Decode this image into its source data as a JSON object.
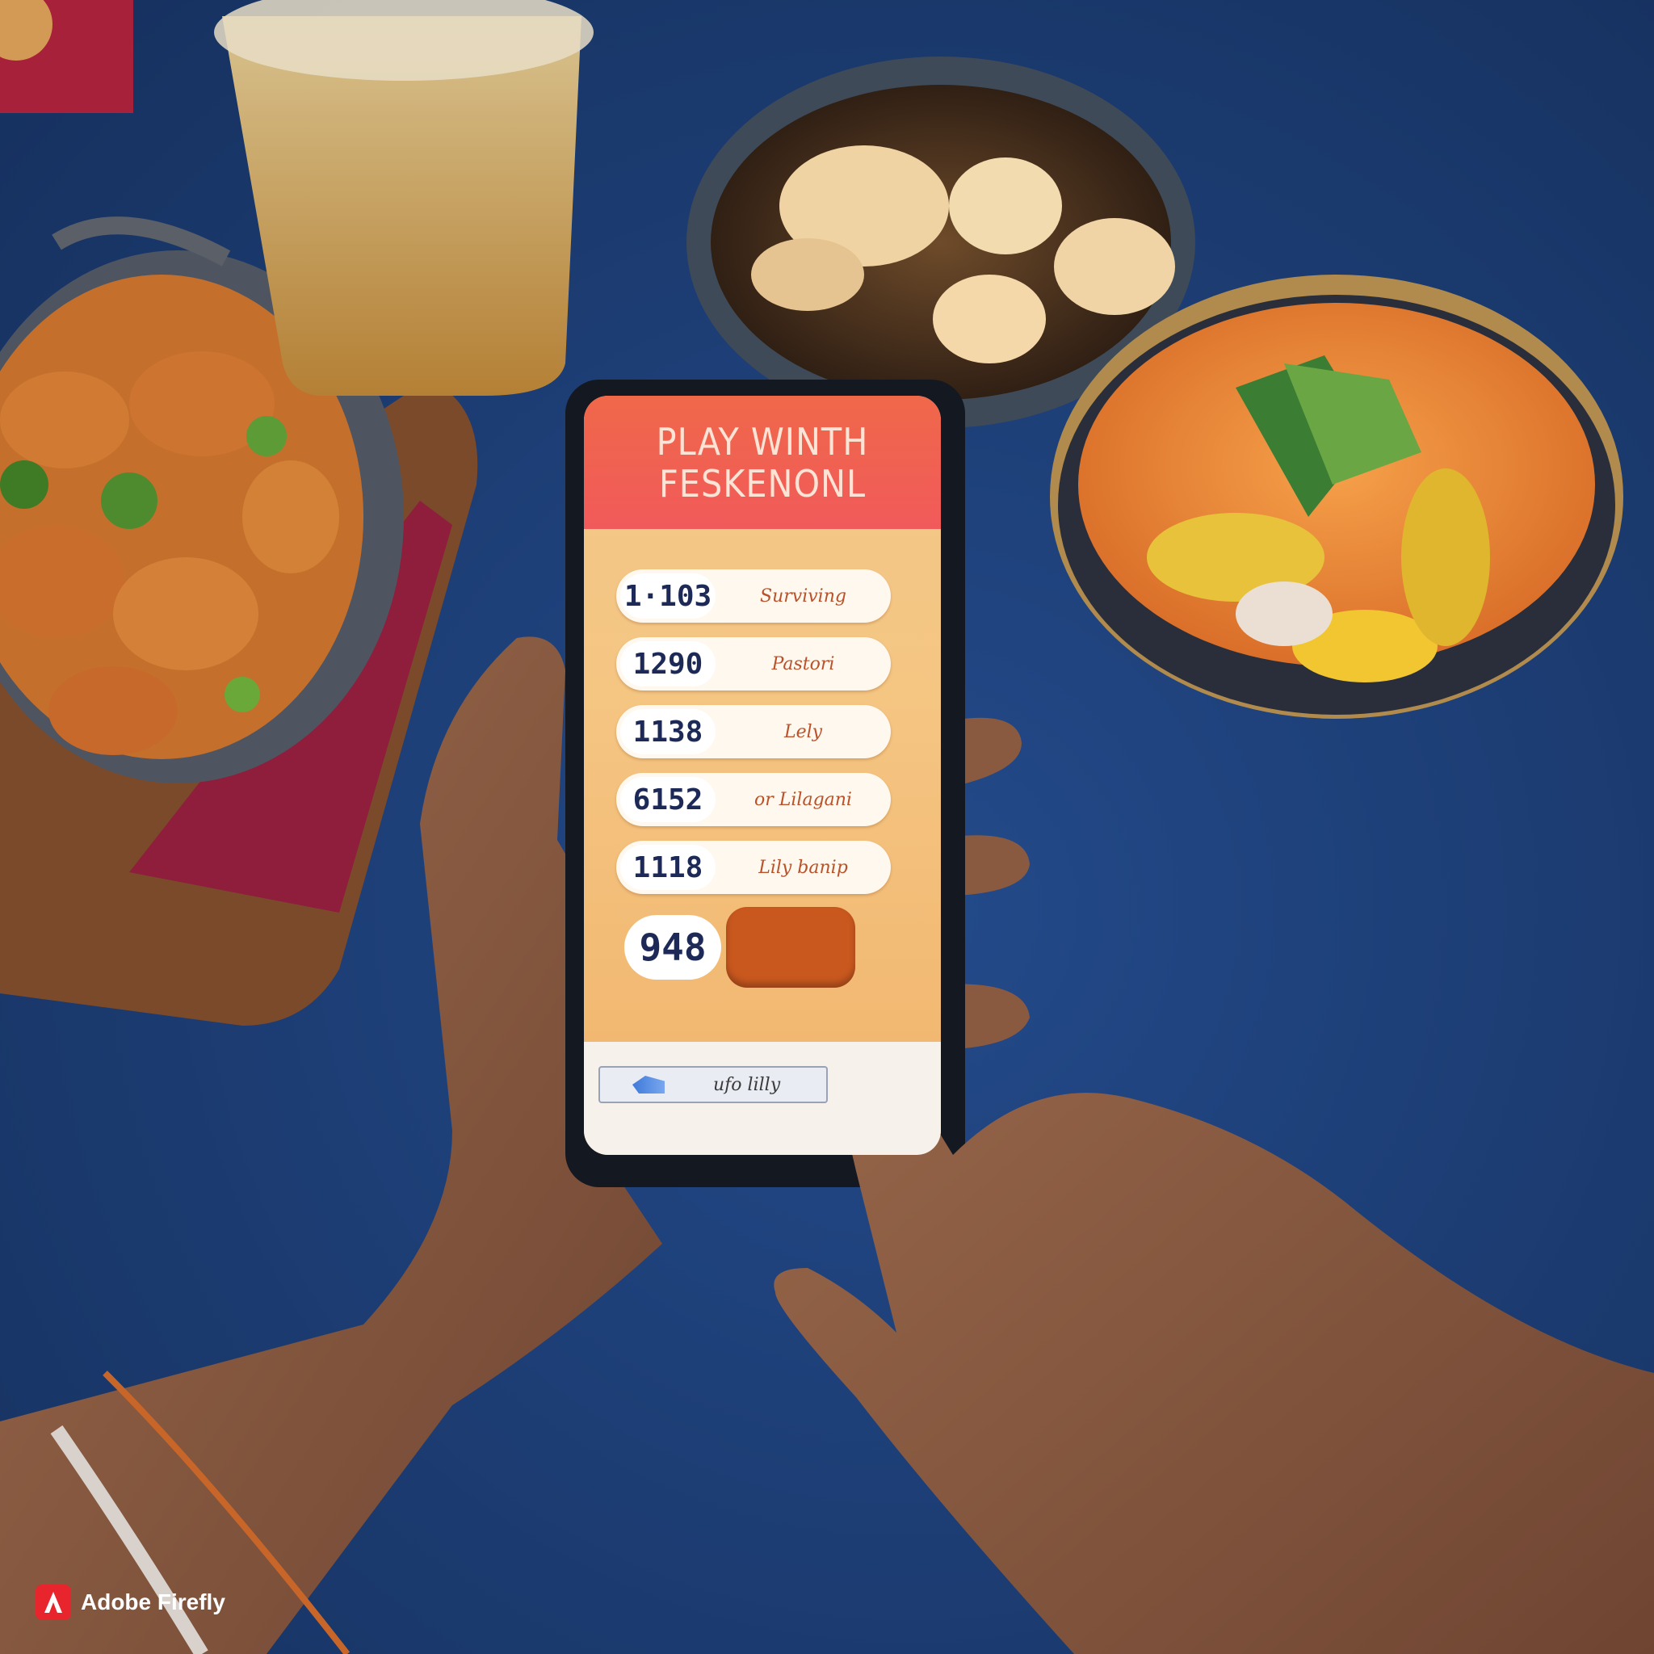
{
  "app": {
    "title_line1": "PLAY WINTH",
    "title_line2": "FESKENONL"
  },
  "scores": [
    {
      "value": "1·103",
      "name": "Surviving"
    },
    {
      "value": "1290",
      "name": "Pastori"
    },
    {
      "value": "1138",
      "name": "Lely"
    },
    {
      "value": "6152",
      "name": "or Lilagani"
    },
    {
      "value": "1118",
      "name": "Lily banip"
    }
  ],
  "final_score": "948",
  "bottom_bar": {
    "label": "ufo lilly"
  },
  "watermark": {
    "text": "Adobe Firefly"
  },
  "colors": {
    "tablecloth": "#1f3f7a",
    "header_red": "#f15a5a",
    "screen_orange": "#f5c582",
    "button_orange": "#c9581f"
  }
}
